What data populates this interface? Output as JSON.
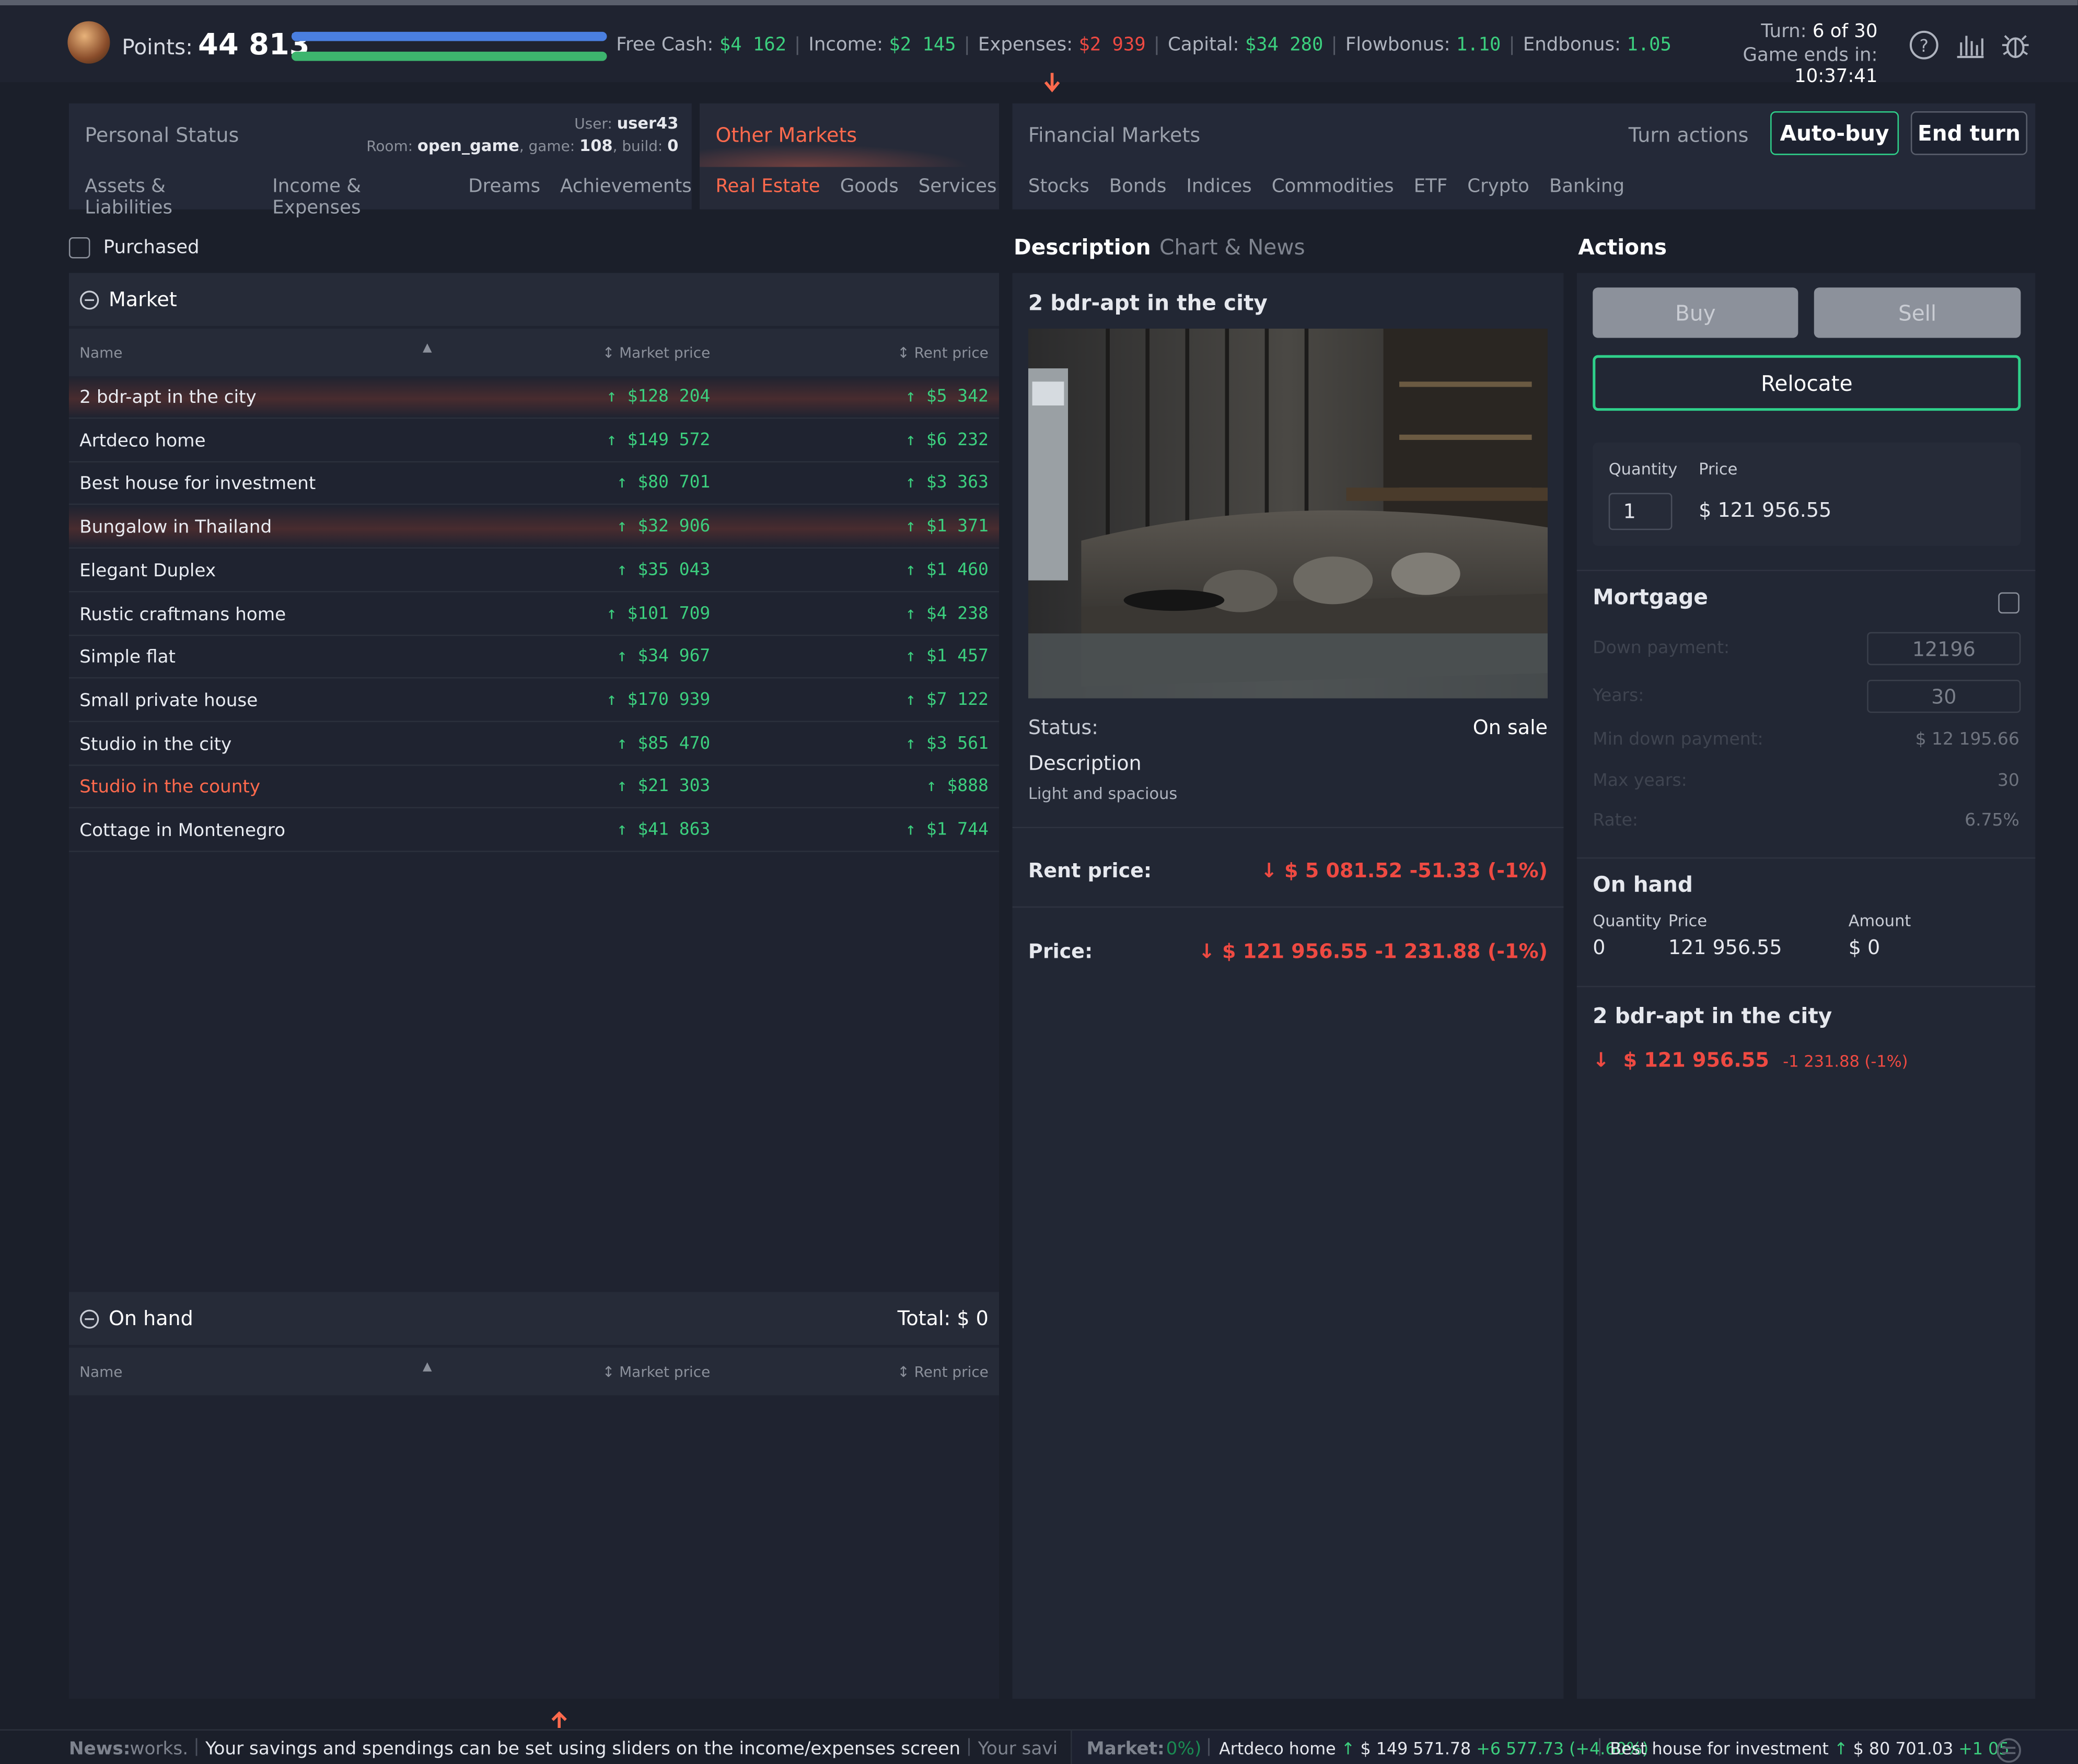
{
  "topbar": {
    "points_label": "Points:",
    "points_value": "44 813",
    "free_cash_label": "Free Cash:",
    "free_cash": "$4 162",
    "income_label": "Income:",
    "income": "$2 145",
    "expenses_label": "Expenses:",
    "expenses": "$2 939",
    "capital_label": "Capital:",
    "capital": "$34 280",
    "flowbonus_label": "Flowbonus:",
    "flowbonus": "1.10",
    "endbonus_label": "Endbonus:",
    "endbonus": "1.05",
    "turn_label": "Turn:",
    "turn_value": "6 of 30",
    "ends_label": "Game ends in:",
    "ends_value": "10:37:41",
    "icons": [
      "help-icon",
      "chart-icon",
      "bug-icon"
    ]
  },
  "nav": {
    "personal_status": "Personal Status",
    "user_label": "User:",
    "user": "user43",
    "room_label": "Room:",
    "room": "open_game",
    "game_label": "game:",
    "game": "108",
    "build_label": "build:",
    "build": "0",
    "personal_tabs": [
      "Assets & Liabilities",
      "Income & Expenses",
      "Dreams",
      "Achievements"
    ],
    "other_markets": "Other Markets",
    "other_tabs": [
      "Real Estate",
      "Goods",
      "Services"
    ],
    "financial_markets": "Financial Markets",
    "financial_tabs": [
      "Stocks",
      "Bonds",
      "Indices",
      "Commodities",
      "ETF",
      "Crypto",
      "Banking"
    ],
    "turn_actions": "Turn actions",
    "auto_buy": "Auto-buy",
    "end_turn": "End turn"
  },
  "left": {
    "purchased_label": "Purchased",
    "market_title": "Market",
    "col_name": "Name",
    "col_market_price": "Market price",
    "col_rent_price": "Rent price",
    "rows": [
      {
        "name": "2 bdr-apt in the city",
        "market_price": "$128 204",
        "rent_price": "$5 342"
      },
      {
        "name": "Artdeco home",
        "market_price": "$149 572",
        "rent_price": "$6 232"
      },
      {
        "name": "Best house for investment",
        "market_price": "$80 701",
        "rent_price": "$3 363"
      },
      {
        "name": "Bungalow in Thailand",
        "market_price": "$32 906",
        "rent_price": "$1 371"
      },
      {
        "name": "Elegant Duplex",
        "market_price": "$35 043",
        "rent_price": "$1 460"
      },
      {
        "name": "Rustic craftmans home",
        "market_price": "$101 709",
        "rent_price": "$4 238"
      },
      {
        "name": "Simple flat",
        "market_price": "$34 967",
        "rent_price": "$1 457"
      },
      {
        "name": "Small private house",
        "market_price": "$170 939",
        "rent_price": "$7 122"
      },
      {
        "name": "Studio in the city",
        "market_price": "$85 470",
        "rent_price": "$3 561"
      },
      {
        "name": "Studio in the county",
        "market_price": "$21 303",
        "rent_price": "$888"
      },
      {
        "name": "Cottage in Montenegro",
        "market_price": "$41 863",
        "rent_price": "$1 744"
      }
    ],
    "on_hand_title": "On hand",
    "on_hand_total": "Total: $ 0"
  },
  "middle": {
    "tab_description": "Description",
    "tab_chart": "Chart & News",
    "title": "2 bdr-apt in the city",
    "status_label": "Status:",
    "status_value": "On sale",
    "description_label": "Description",
    "description_text": "Light and spacious",
    "rent_label": "Rent price:",
    "rent_value": "$ 5 081.52 -51.33 (-1%)",
    "price_label": "Price:",
    "price_value": "$ 121 956.55 -1 231.88 (-1%)"
  },
  "actions": {
    "title": "Actions",
    "buy": "Buy",
    "sell": "Sell",
    "relocate": "Relocate",
    "quantity_label": "Quantity",
    "price_label": "Price",
    "quantity_value": "1",
    "price_value": "$ 121 956.55",
    "mortgage_title": "Mortgage",
    "down_payment_label": "Down payment:",
    "down_payment_value": "12196",
    "years_label": "Years:",
    "years_value": "30",
    "min_down_label": "Min down payment:",
    "min_down_value": "$ 12 195.66",
    "max_years_label": "Max years:",
    "max_years_value": "30",
    "rate_label": "Rate:",
    "rate_value": "6.75%",
    "on_hand_title": "On hand",
    "oh_qty_label": "Quantity",
    "oh_price_label": "Price",
    "oh_amount_label": "Amount",
    "oh_qty": "0",
    "oh_price": "121 956.55",
    "oh_amount": "$ 0",
    "summary_title": "2 bdr-apt in the city",
    "summary_price": "$ 121 956.55",
    "summary_change": "-1 231.88 (-1%)"
  },
  "news": {
    "news_label": "News:",
    "news_tail": "works.",
    "news_item": "Your savings and spendings can be set using sliders on the income/expenses screen",
    "news_cut": "Your savi",
    "market_label": "Market:",
    "market_cut": "0%)",
    "m1_name": "Artdeco home",
    "m1_price": "$ 149 571.78",
    "m1_change": "+6 577.73 (+4.60%)",
    "m2_name": "Best house for investment",
    "m2_price": "$ 80 701.03",
    "m2_change": "+1 05"
  },
  "colors": {
    "accent": "#ff6a4d",
    "positive": "#3ccf7e",
    "negative": "#ef4a42",
    "relocate_border": "#2fd08a"
  }
}
